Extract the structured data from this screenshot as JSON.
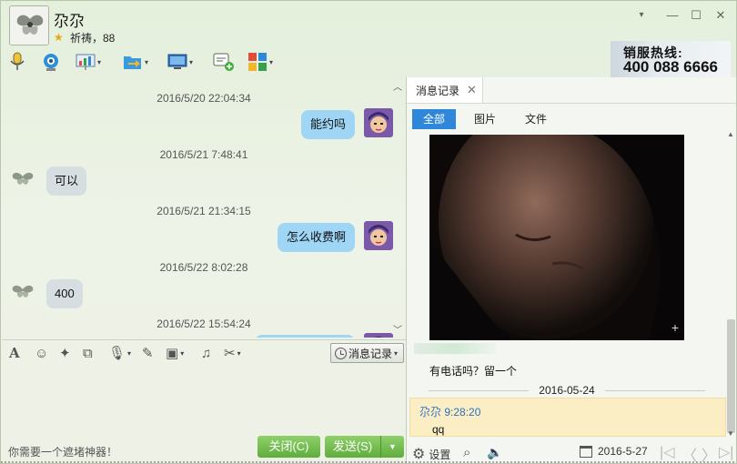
{
  "title_bar": {
    "contact_name": "尕尕",
    "contact_status": "祈祷，88",
    "minimize_label": "—",
    "maximize_label": "☐",
    "close_label": "✕",
    "settings_caret": "▾"
  },
  "ad": {
    "line1": "销服热线:",
    "line2": "400 088 6666"
  },
  "toolbar": {
    "icons": [
      "voice-call-icon",
      "video-call-icon",
      "screen-share-icon",
      "file-transfer-icon",
      "remote-desktop-icon",
      "add-chat-icon",
      "apps-icon"
    ]
  },
  "chat": {
    "messages": [
      {
        "time": "2016/5/20 22:04:34",
        "side": "me",
        "text": "能约吗"
      },
      {
        "time": "2016/5/21 7:48:41",
        "side": "them",
        "text": "可以"
      },
      {
        "time": "2016/5/21 21:34:15",
        "side": "me",
        "text": "怎么收费啊"
      },
      {
        "time": "2016/5/22 8:02:28",
        "side": "them",
        "text": "400"
      },
      {
        "time": "2016/5/22 15:54:24",
        "side": "me",
        "text": ""
      }
    ]
  },
  "input": {
    "history_label": "消息记录",
    "hint": "你需要一个遮堵神器！",
    "close_label": "关闭(C)",
    "send_label": "发送(S)"
  },
  "right_panel": {
    "tab_title": "消息记录",
    "filters": [
      "全部",
      "图片",
      "文件"
    ],
    "history_message": "有电话吗？留一个",
    "date_separator": "2016-05-24",
    "highlight_sender": "尕尕  9:28:20",
    "highlight_body": "qq",
    "settings_label": "设置",
    "date": "2016-5-27"
  },
  "colors": {
    "accent_blue": "#2f87d9",
    "my_bubble": "#9fd5f5",
    "their_bubble": "#d6dee2",
    "send_green": "#60ad3d",
    "highlight_bg": "#fbeec4"
  }
}
